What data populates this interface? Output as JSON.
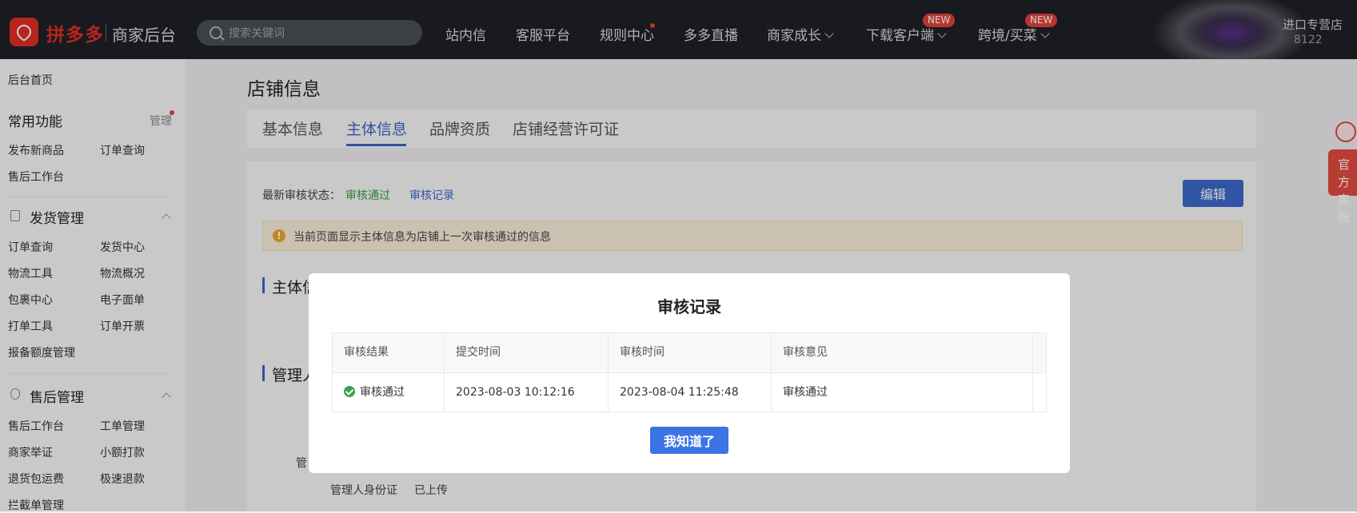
{
  "header": {
    "brand": "拼多多",
    "subtitle": "商家后台",
    "search_placeholder": "搜索关键词",
    "nav": [
      "站内信",
      "客服平台",
      "规则中心",
      "多多直播",
      "商家成长",
      "下载客户端",
      "跨境/买菜"
    ],
    "new_badge": "NEW",
    "shop_name": "进口专营店",
    "shop_id": "8122"
  },
  "sidebar": {
    "home": "后台首页",
    "common": {
      "title": "常用功能",
      "manage": "管理",
      "items": [
        "发布新商品",
        "订单查询",
        "售后工作台"
      ]
    },
    "shipping": {
      "title": "发货管理",
      "items": [
        "订单查询",
        "发货中心",
        "物流工具",
        "物流概况",
        "包裹中心",
        "电子面单",
        "打单工具",
        "订单开票",
        "报备额度管理"
      ]
    },
    "aftersale": {
      "title": "售后管理",
      "items": [
        "售后工作台",
        "工单管理",
        "商家举证",
        "小额打款",
        "退货包运费",
        "极速退款",
        "拦截单管理"
      ]
    }
  },
  "page": {
    "title": "店铺信息",
    "tabs": [
      "基本信息",
      "主体信息",
      "品牌资质",
      "店铺经营许可证"
    ],
    "active_tab": "主体信息",
    "status_label": "最新审核状态：",
    "status_value": "审核通过",
    "audit_link": "审核记录",
    "edit_button": "编辑",
    "notice": "当前页面显示主体信息为店铺上一次审核通过的信息",
    "section1": "主体信",
    "section2": "管理人",
    "field_label_partial": "管",
    "id_label": "管理人身份证",
    "id_value": "已上传"
  },
  "float": {
    "line1": "官方",
    "line2": "客服"
  },
  "modal": {
    "title": "审核记录",
    "columns": [
      "审核结果",
      "提交时间",
      "审核时间",
      "审核意见"
    ],
    "rows": [
      {
        "result": "审核通过",
        "submit_time": "2023-08-03 10:12:16",
        "review_time": "2023-08-04 11:25:48",
        "opinion": "审核通过"
      }
    ],
    "ok_button": "我知道了"
  },
  "colors": {
    "accent": "#3c68c8",
    "brand_red": "#e02e24",
    "success": "#3ba24a",
    "warning": "#e8a52a"
  }
}
